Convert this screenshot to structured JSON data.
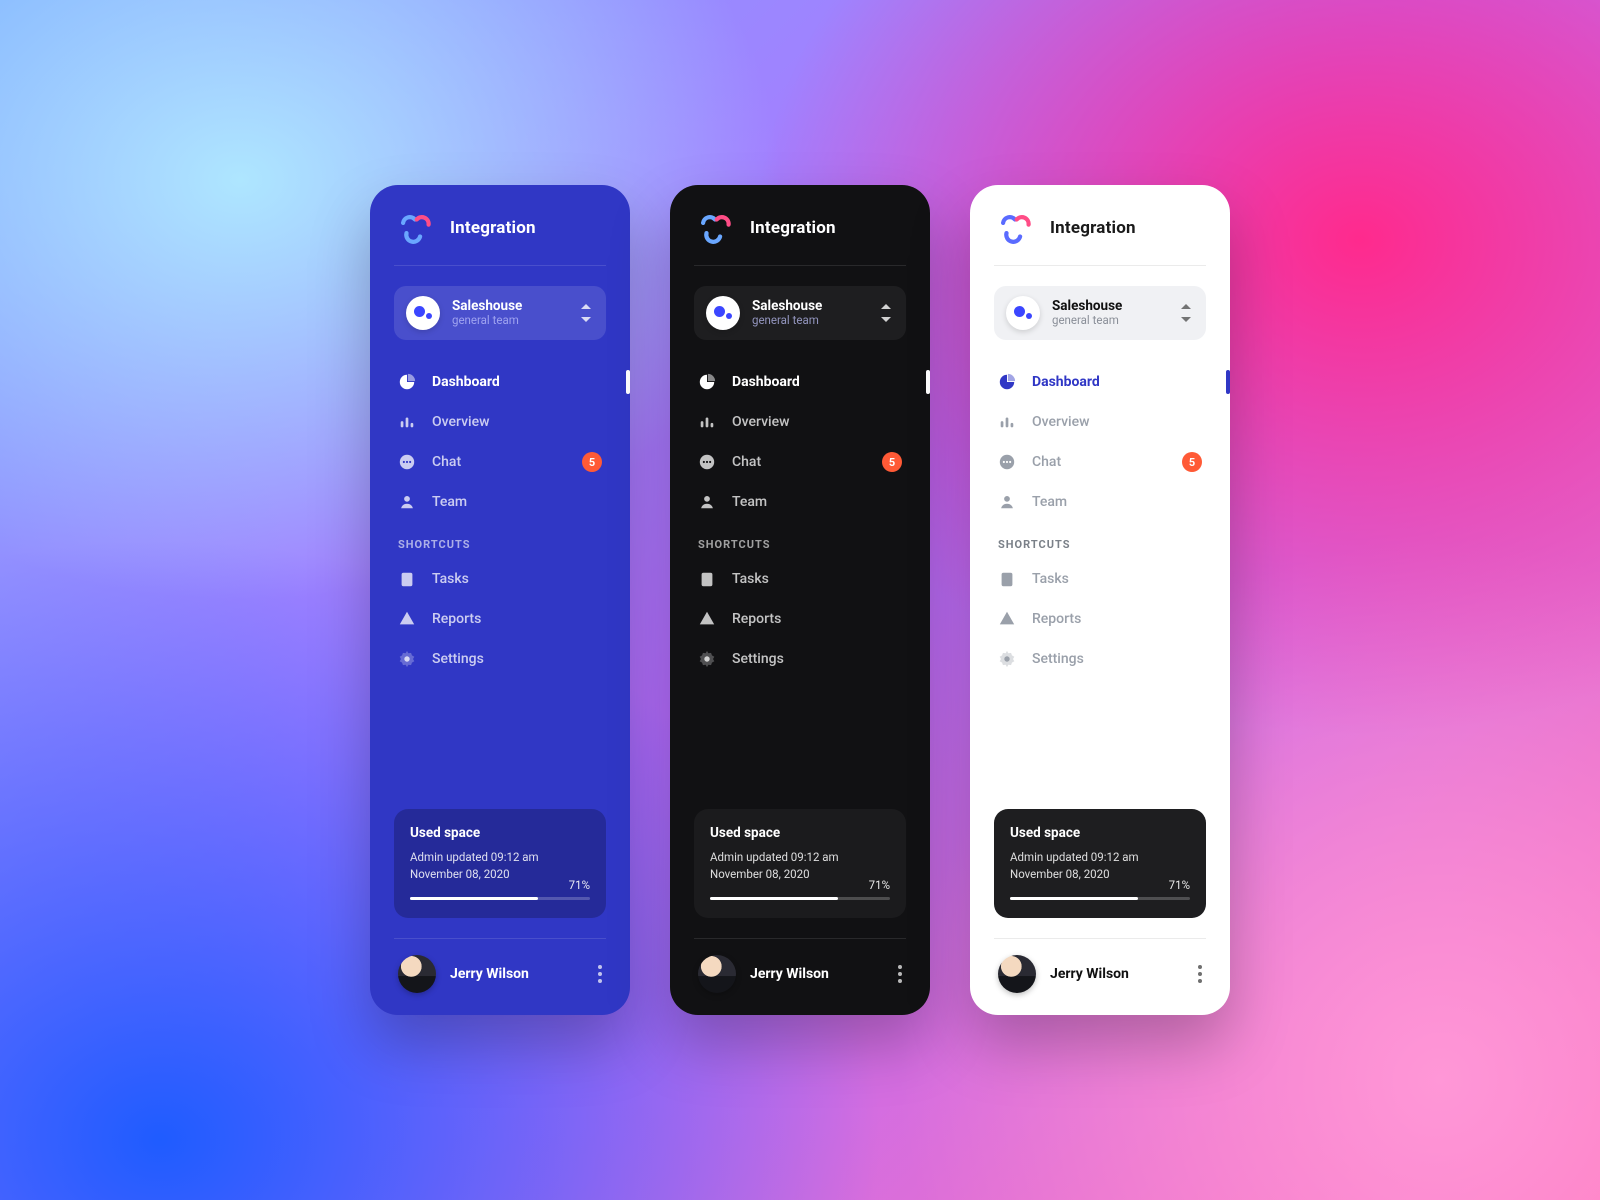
{
  "app_title": "Integration",
  "org": {
    "name": "Saleshouse",
    "subtitle": "general team"
  },
  "nav": {
    "items": [
      {
        "label": "Dashboard",
        "icon": "pie-chart-icon",
        "active": true
      },
      {
        "label": "Overview",
        "icon": "bar-chart-icon"
      },
      {
        "label": "Chat",
        "icon": "chat-icon",
        "badge": 5
      },
      {
        "label": "Team",
        "icon": "user-icon"
      }
    ]
  },
  "shortcuts": {
    "label": "SHORTCUTS",
    "items": [
      {
        "label": "Tasks",
        "icon": "clipboard-icon"
      },
      {
        "label": "Reports",
        "icon": "warning-icon"
      },
      {
        "label": "Settings",
        "icon": "gear-icon"
      }
    ]
  },
  "used_space": {
    "title": "Used space",
    "line1": "Admin updated 09:12 am",
    "line2": "November 08, 2020",
    "percent_label": "71%",
    "percent": 71
  },
  "user": {
    "name": "Jerry Wilson"
  },
  "themes": [
    "blue",
    "dark",
    "light"
  ],
  "colors": {
    "accent_blue": "#3037c5",
    "badge": "#ff5a36"
  }
}
